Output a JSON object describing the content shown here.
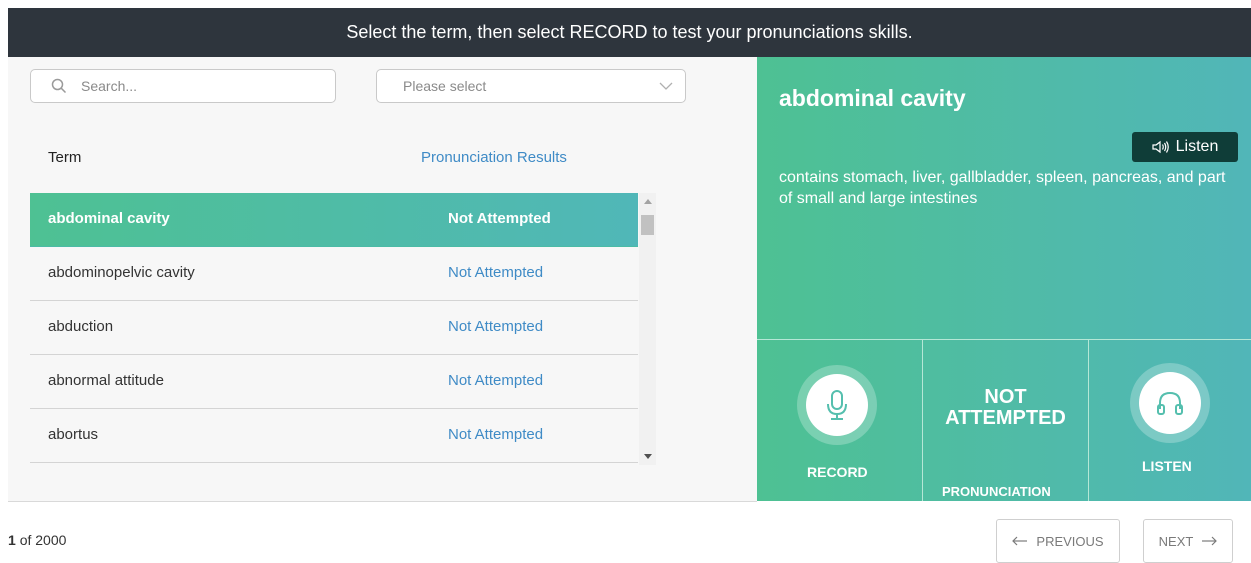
{
  "banner": {
    "text": "Select the term, then select RECORD to test your pronunciations skills."
  },
  "search": {
    "placeholder": "Search..."
  },
  "filter": {
    "selected": "Please select"
  },
  "table": {
    "headers": {
      "term": "Term",
      "results": "Pronunciation Results"
    },
    "rows": [
      {
        "term": "abdominal cavity",
        "result": "Not Attempted",
        "selected": true
      },
      {
        "term": "abdominopelvic cavity",
        "result": "Not Attempted"
      },
      {
        "term": "abduction",
        "result": "Not Attempted"
      },
      {
        "term": "abnormal attitude",
        "result": "Not Attempted"
      },
      {
        "term": "abortus",
        "result": "Not Attempted"
      }
    ]
  },
  "detail": {
    "title": "abdominal cavity",
    "listen_button": "Listen",
    "definition": "contains stomach, liver, gallbladder, spleen, pancreas, and part of small and large intestines"
  },
  "actions": {
    "record_label": "RECORD",
    "status_line1": "NOT",
    "status_line2": "ATTEMPTED",
    "pronunciation_label": "PRONUNCIATION",
    "listen_label": "LISTEN"
  },
  "pagination": {
    "current": "1",
    "of_total": "of 2000",
    "previous": "PREVIOUS",
    "next": "NEXT"
  },
  "colors": {
    "banner_bg": "#2e353d",
    "accent_green": "#4ec193",
    "accent_teal": "#51b6b8",
    "link_blue": "#3f8bc6",
    "listen_btn_bg": "#0f3d38"
  }
}
